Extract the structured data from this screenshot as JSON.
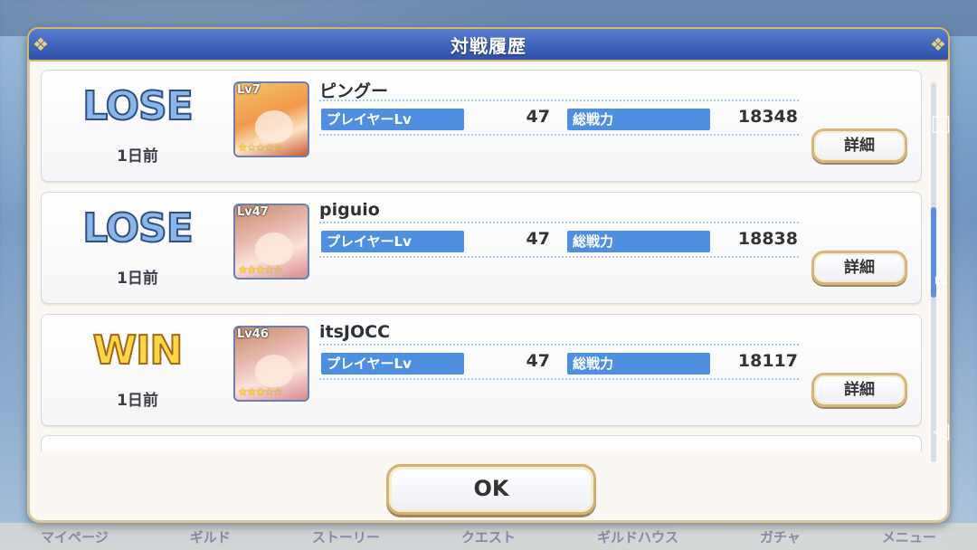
{
  "dialog": {
    "title": "対戦履歴",
    "ok_label": "OK"
  },
  "background_nav": [
    "マイページ",
    "ギルド",
    "ストーリー",
    "クエスト",
    "ギルドハウス",
    "ガチャ",
    "メニュー"
  ],
  "battles": [
    {
      "result": "LOSE",
      "time": "1日前",
      "avatar_level": "Lv7",
      "avatar_stars": "★☆☆☆☆",
      "player_name": "ピングー",
      "stat1_label": "プレイヤーLv",
      "stat1_value": "47",
      "stat2_label": "総戦力",
      "stat2_value": "18348",
      "detail_label": "詳細"
    },
    {
      "result": "LOSE",
      "time": "1日前",
      "avatar_level": "Lv47",
      "avatar_stars": "★★★☆☆",
      "player_name": "piguio",
      "stat1_label": "プレイヤーLv",
      "stat1_value": "47",
      "stat2_label": "総戦力",
      "stat2_value": "18838",
      "detail_label": "詳細"
    },
    {
      "result": "WIN",
      "time": "1日前",
      "avatar_level": "Lv46",
      "avatar_stars": "★★★☆☆",
      "player_name": "itsJOCC",
      "stat1_label": "プレイヤーLv",
      "stat1_value": "47",
      "stat2_label": "総戦力",
      "stat2_value": "18117",
      "detail_label": "詳細"
    }
  ],
  "system_nav": {
    "square_icon": "□",
    "home_icon": "⌂",
    "back_icon": "◁"
  },
  "colors": {
    "header_blue": "#3e63bb",
    "stat_label_blue": "#4f8fdf",
    "lose_blue": "#8cb6e6",
    "win_gold": "#ffd648",
    "frame_gold": "#d6b67a"
  }
}
